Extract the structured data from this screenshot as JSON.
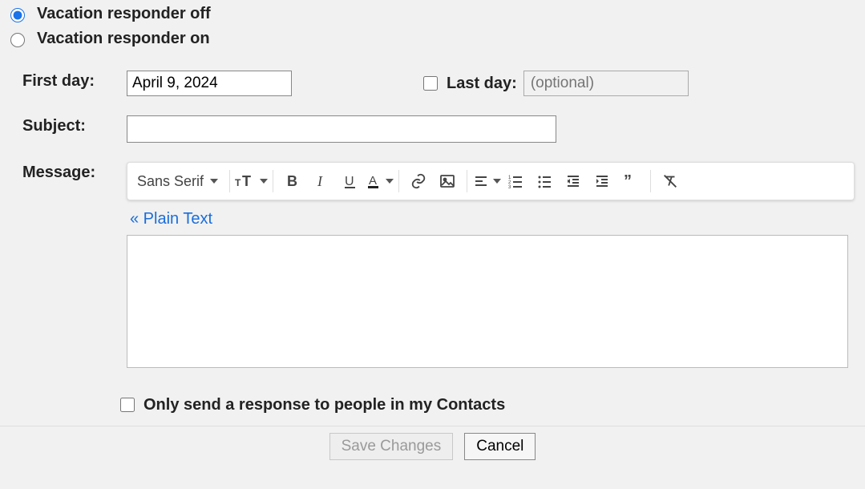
{
  "radios": {
    "off_label": "Vacation responder off",
    "on_label": "Vacation responder on",
    "selected": "off"
  },
  "first_day": {
    "label": "First day:",
    "value": "April 9, 2024"
  },
  "last_day": {
    "label": "Last day:",
    "placeholder": "(optional)"
  },
  "subject": {
    "label": "Subject:",
    "value": ""
  },
  "message": {
    "label": "Message:"
  },
  "toolbar": {
    "font": "Sans Serif",
    "plain_text": "« Plain Text"
  },
  "contacts_only_label": "Only send a response to people in my Contacts",
  "footer": {
    "save": "Save Changes",
    "cancel": "Cancel"
  }
}
